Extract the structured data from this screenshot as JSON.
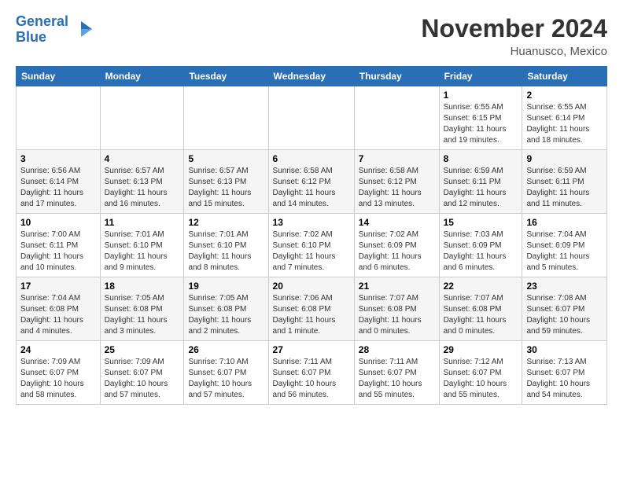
{
  "header": {
    "logo_line1": "General",
    "logo_line2": "Blue",
    "title": "November 2024",
    "subtitle": "Huanusco, Mexico"
  },
  "weekdays": [
    "Sunday",
    "Monday",
    "Tuesday",
    "Wednesday",
    "Thursday",
    "Friday",
    "Saturday"
  ],
  "weeks": [
    [
      {
        "day": "",
        "info": ""
      },
      {
        "day": "",
        "info": ""
      },
      {
        "day": "",
        "info": ""
      },
      {
        "day": "",
        "info": ""
      },
      {
        "day": "",
        "info": ""
      },
      {
        "day": "1",
        "info": "Sunrise: 6:55 AM\nSunset: 6:15 PM\nDaylight: 11 hours\nand 19 minutes."
      },
      {
        "day": "2",
        "info": "Sunrise: 6:55 AM\nSunset: 6:14 PM\nDaylight: 11 hours\nand 18 minutes."
      }
    ],
    [
      {
        "day": "3",
        "info": "Sunrise: 6:56 AM\nSunset: 6:14 PM\nDaylight: 11 hours\nand 17 minutes."
      },
      {
        "day": "4",
        "info": "Sunrise: 6:57 AM\nSunset: 6:13 PM\nDaylight: 11 hours\nand 16 minutes."
      },
      {
        "day": "5",
        "info": "Sunrise: 6:57 AM\nSunset: 6:13 PM\nDaylight: 11 hours\nand 15 minutes."
      },
      {
        "day": "6",
        "info": "Sunrise: 6:58 AM\nSunset: 6:12 PM\nDaylight: 11 hours\nand 14 minutes."
      },
      {
        "day": "7",
        "info": "Sunrise: 6:58 AM\nSunset: 6:12 PM\nDaylight: 11 hours\nand 13 minutes."
      },
      {
        "day": "8",
        "info": "Sunrise: 6:59 AM\nSunset: 6:11 PM\nDaylight: 11 hours\nand 12 minutes."
      },
      {
        "day": "9",
        "info": "Sunrise: 6:59 AM\nSunset: 6:11 PM\nDaylight: 11 hours\nand 11 minutes."
      }
    ],
    [
      {
        "day": "10",
        "info": "Sunrise: 7:00 AM\nSunset: 6:11 PM\nDaylight: 11 hours\nand 10 minutes."
      },
      {
        "day": "11",
        "info": "Sunrise: 7:01 AM\nSunset: 6:10 PM\nDaylight: 11 hours\nand 9 minutes."
      },
      {
        "day": "12",
        "info": "Sunrise: 7:01 AM\nSunset: 6:10 PM\nDaylight: 11 hours\nand 8 minutes."
      },
      {
        "day": "13",
        "info": "Sunrise: 7:02 AM\nSunset: 6:10 PM\nDaylight: 11 hours\nand 7 minutes."
      },
      {
        "day": "14",
        "info": "Sunrise: 7:02 AM\nSunset: 6:09 PM\nDaylight: 11 hours\nand 6 minutes."
      },
      {
        "day": "15",
        "info": "Sunrise: 7:03 AM\nSunset: 6:09 PM\nDaylight: 11 hours\nand 6 minutes."
      },
      {
        "day": "16",
        "info": "Sunrise: 7:04 AM\nSunset: 6:09 PM\nDaylight: 11 hours\nand 5 minutes."
      }
    ],
    [
      {
        "day": "17",
        "info": "Sunrise: 7:04 AM\nSunset: 6:08 PM\nDaylight: 11 hours\nand 4 minutes."
      },
      {
        "day": "18",
        "info": "Sunrise: 7:05 AM\nSunset: 6:08 PM\nDaylight: 11 hours\nand 3 minutes."
      },
      {
        "day": "19",
        "info": "Sunrise: 7:05 AM\nSunset: 6:08 PM\nDaylight: 11 hours\nand 2 minutes."
      },
      {
        "day": "20",
        "info": "Sunrise: 7:06 AM\nSunset: 6:08 PM\nDaylight: 11 hours\nand 1 minute."
      },
      {
        "day": "21",
        "info": "Sunrise: 7:07 AM\nSunset: 6:08 PM\nDaylight: 11 hours\nand 0 minutes."
      },
      {
        "day": "22",
        "info": "Sunrise: 7:07 AM\nSunset: 6:08 PM\nDaylight: 11 hours\nand 0 minutes."
      },
      {
        "day": "23",
        "info": "Sunrise: 7:08 AM\nSunset: 6:07 PM\nDaylight: 10 hours\nand 59 minutes."
      }
    ],
    [
      {
        "day": "24",
        "info": "Sunrise: 7:09 AM\nSunset: 6:07 PM\nDaylight: 10 hours\nand 58 minutes."
      },
      {
        "day": "25",
        "info": "Sunrise: 7:09 AM\nSunset: 6:07 PM\nDaylight: 10 hours\nand 57 minutes."
      },
      {
        "day": "26",
        "info": "Sunrise: 7:10 AM\nSunset: 6:07 PM\nDaylight: 10 hours\nand 57 minutes."
      },
      {
        "day": "27",
        "info": "Sunrise: 7:11 AM\nSunset: 6:07 PM\nDaylight: 10 hours\nand 56 minutes."
      },
      {
        "day": "28",
        "info": "Sunrise: 7:11 AM\nSunset: 6:07 PM\nDaylight: 10 hours\nand 55 minutes."
      },
      {
        "day": "29",
        "info": "Sunrise: 7:12 AM\nSunset: 6:07 PM\nDaylight: 10 hours\nand 55 minutes."
      },
      {
        "day": "30",
        "info": "Sunrise: 7:13 AM\nSunset: 6:07 PM\nDaylight: 10 hours\nand 54 minutes."
      }
    ]
  ]
}
